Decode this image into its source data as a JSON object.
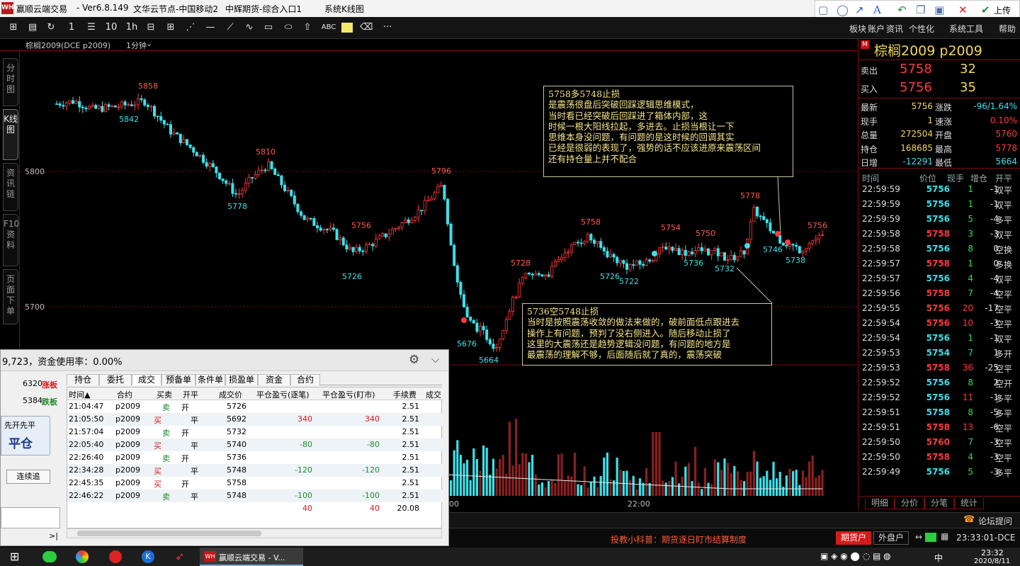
{
  "titlebar": {
    "logo": "WH",
    "app_name": "赢顺云端交易",
    "version": "- Ver6.8.149",
    "node": "文华云节点-中国移动2",
    "futures": "中辉期货-综合入口1",
    "kline_title": "系统K线图"
  },
  "drawtools": {
    "upload_label": "上传"
  },
  "toolbar": {
    "period_1": "1",
    "period_2": "10",
    "period_3": "1h",
    "abc_label": "ABC",
    "more_label": "···"
  },
  "menu": [
    "板块",
    "账户",
    "资讯",
    "个性化",
    "系统工具",
    "帮助"
  ],
  "chartbar": {
    "symbol": "棕榈2009(DCE p2009)",
    "period": "1分钟"
  },
  "side_tabs": [
    "分时图",
    "K线图",
    "资讯链",
    "F10资料",
    "页面下单"
  ],
  "chart": {
    "price_labels": [
      "5800",
      "5700"
    ],
    "time_labels": [
      "00",
      "22:00"
    ],
    "marks": [
      "5858",
      "5842",
      "5810",
      "5778",
      "5796",
      "5756",
      "5726",
      "5728",
      "5676",
      "5664",
      "5758",
      "5754",
      "5750",
      "5726",
      "5722",
      "5736",
      "5732",
      "5778",
      "5746",
      "5756",
      "5738"
    ],
    "bid_marker": "M"
  },
  "chart_data": {
    "type": "candlestick",
    "title": "棕榈2009(DCE p2009)",
    "period": "1分钟",
    "price_axis": [
      "5800",
      "5700"
    ],
    "annotated_highs": [
      5858,
      5810,
      5796,
      5756,
      5728,
      5758,
      5754,
      5750,
      5778,
      5756
    ],
    "annotated_lows": [
      5842,
      5778,
      5726,
      5676,
      5664,
      5726,
      5722,
      5736,
      5732,
      5746,
      5738
    ],
    "colors": {
      "up": "#ff3b3b",
      "down": "#3ee0e8"
    }
  },
  "notes": {
    "long": "5758多5748止损\n是震荡很盘后突破回踩逻辑思维模式，\n当时看已经突破后回踩进了箱体内部，这\n时候一根大阳线拉起，多进去。止损当根让一下\n思维本身没问题，有问题的是这时候的回调其实\n已经是很弱的表现了，强势的话不应该进原来震荡区间\n还有持仓量上并不配合",
    "short": "5736空5748止损\n当时是按照震荡收敛的做法来做的，破前面低点跟进去\n操作上有问题，预判了没右侧进入。随后移动止损了\n这里的大震荡还是趋势逻辑没问题，有问题的地方是\n最震荡的理解不够，后面随后就了真的，震荡突破"
  },
  "quote": {
    "title": "棕榈2009  p2009",
    "sell_label": "卖出",
    "sell_price": "5758",
    "sell_vol": "32",
    "buy_label": "买入",
    "buy_price": "5756",
    "buy_vol": "35",
    "stats": [
      {
        "l1": "最新",
        "v1": "5756",
        "l2": "涨跌",
        "v2": "-96/1.64%"
      },
      {
        "l1": "现手",
        "v1": "1",
        "l2": "速涨",
        "v2": "0.10%"
      },
      {
        "l1": "总量",
        "v1": "272504",
        "l2": "开盘",
        "v2": "5760"
      },
      {
        "l1": "持仓",
        "v1": "168685",
        "l2": "最高",
        "v2": "5778"
      },
      {
        "l1": "日增",
        "v1": "-12291",
        "l2": "最低",
        "v2": "5664"
      }
    ],
    "deal_headers": [
      "时间",
      "价位",
      "现手",
      "增仓",
      "开平"
    ],
    "deals": [
      {
        "time": "22:59:59",
        "price": "5756",
        "vol": "1",
        "chg": "-1",
        "kp": "双平",
        "pc": "#3ee0e8"
      },
      {
        "time": "22:59:59",
        "price": "5756",
        "vol": "1",
        "chg": "-1",
        "kp": "双平",
        "pc": "#3ee0e8"
      },
      {
        "time": "22:59:59",
        "price": "5756",
        "vol": "5",
        "chg": "-4",
        "kp": "多平",
        "pc": "#3ee0e8"
      },
      {
        "time": "22:59:58",
        "price": "5758",
        "vol": "3",
        "chg": "-3",
        "kp": "双平",
        "pc": "#ff3b3b"
      },
      {
        "time": "22:59:58",
        "price": "5756",
        "vol": "8",
        "chg": "0",
        "kp": "空换",
        "pc": "#3ee0e8"
      },
      {
        "time": "22:59:57",
        "price": "5758",
        "vol": "1",
        "chg": "0",
        "kp": "多换",
        "pc": "#ff3b3b"
      },
      {
        "time": "22:59:57",
        "price": "5756",
        "vol": "4",
        "chg": "-4",
        "kp": "双平",
        "pc": "#3ee0e8"
      },
      {
        "time": "22:59:56",
        "price": "5758",
        "vol": "7",
        "chg": "-4",
        "kp": "空平",
        "pc": "#ff3b3b"
      },
      {
        "time": "22:59:55",
        "price": "5756",
        "vol": "20",
        "chg": "-17",
        "kp": "空平",
        "pc": "#ff3b3b"
      },
      {
        "time": "22:59:54",
        "price": "5756",
        "vol": "10",
        "chg": "-3",
        "kp": "空平",
        "pc": "#ff3b3b"
      },
      {
        "time": "22:59:54",
        "price": "5756",
        "vol": "1",
        "chg": "-1",
        "kp": "双平",
        "pc": "#3ee0e8"
      },
      {
        "time": "22:59:53",
        "price": "5754",
        "vol": "7",
        "chg": "1",
        "kp": "多开",
        "pc": "#3ee0e8"
      },
      {
        "time": "22:59:53",
        "price": "5758",
        "vol": "36",
        "chg": "-25",
        "kp": "空平",
        "pc": "#ff3b3b"
      },
      {
        "time": "22:59:52",
        "price": "5756",
        "vol": "8",
        "chg": "2",
        "kp": "空开",
        "pc": "#3ee0e8"
      },
      {
        "time": "22:59:52",
        "price": "5756",
        "vol": "11",
        "chg": "-1",
        "kp": "多平",
        "pc": "#3ee0e8"
      },
      {
        "time": "22:59:51",
        "price": "5758",
        "vol": "8",
        "chg": "-5",
        "kp": "多平",
        "pc": "#3ee0e8"
      },
      {
        "time": "22:59:51",
        "price": "5758",
        "vol": "13",
        "chg": "-6",
        "kp": "空平",
        "pc": "#ff3b3b"
      },
      {
        "time": "22:59:50",
        "price": "5760",
        "vol": "7",
        "chg": "-3",
        "kp": "空平",
        "pc": "#ff3b3b"
      },
      {
        "time": "22:59:50",
        "price": "5758",
        "vol": "4",
        "chg": "-3",
        "kp": "空平",
        "pc": "#ff3b3b"
      },
      {
        "time": "22:59:49",
        "price": "5756",
        "vol": "5",
        "chg": "-3",
        "kp": "多平",
        "pc": "#3ee0e8"
      }
    ],
    "tabs": [
      "明细",
      "分价",
      "分笔",
      "统计"
    ]
  },
  "statusbar": {
    "forum": "论坛提问"
  },
  "infobar": {
    "tip": "投教小科普：期货逐日盯市结算制度",
    "futures_btn": "期货户",
    "external_btn": "外盘户",
    "clock": "23:33:01-DCE"
  },
  "taskbar": {
    "app": "赢顺云端交易 - V...",
    "time": "23:32",
    "date": "2020/8/11",
    "lang": "中"
  },
  "panel": {
    "header_text": "9,723，资金使用率：0.00%",
    "limit_up_price": "6320",
    "limit_up": "涨板",
    "limit_down_price": "5384",
    "limit_down": "跌板",
    "open_close_mode": "先开先平",
    "close_btn": "平仓",
    "chase_btn": "连续追",
    "tabs": [
      "持仓",
      "委托",
      "成交",
      "预备单",
      "条件单",
      "损盈单",
      "资金",
      "合约"
    ],
    "columns": [
      "时间▲",
      "合约",
      "买卖",
      "开平",
      "成交价",
      "平仓盈亏(逐笔)",
      "平仓盈亏(盯市)",
      "手续费",
      "成交"
    ],
    "rows": [
      {
        "time": "21:04:47",
        "contract": "p2009",
        "side": "卖",
        "kp": "开",
        "price": "5726",
        "pl1": "",
        "pl2": "",
        "fee": "2.51"
      },
      {
        "time": "21:05:50",
        "contract": "p2009",
        "side": "买",
        "kp": "平",
        "price": "5692",
        "pl1": "340",
        "pl2": "340",
        "fee": "2.51"
      },
      {
        "time": "21:57:04",
        "contract": "p2009",
        "side": "卖",
        "kp": "开",
        "price": "5732",
        "pl1": "",
        "pl2": "",
        "fee": "2.51"
      },
      {
        "time": "22:05:40",
        "contract": "p2009",
        "side": "买",
        "kp": "平",
        "price": "5740",
        "pl1": "-80",
        "pl2": "-80",
        "fee": "2.51"
      },
      {
        "time": "22:26:40",
        "contract": "p2009",
        "side": "卖",
        "kp": "开",
        "price": "5736",
        "pl1": "",
        "pl2": "",
        "fee": "2.51"
      },
      {
        "time": "22:34:28",
        "contract": "p2009",
        "side": "买",
        "kp": "平",
        "price": "5748",
        "pl1": "-120",
        "pl2": "-120",
        "fee": "2.51"
      },
      {
        "time": "22:45:35",
        "contract": "p2009",
        "side": "买",
        "kp": "开",
        "price": "5758",
        "pl1": "",
        "pl2": "",
        "fee": "2.51"
      },
      {
        "time": "22:46:22",
        "contract": "p2009",
        "side": "卖",
        "kp": "平",
        "price": "5748",
        "pl1": "-100",
        "pl2": "-100",
        "fee": "2.51"
      }
    ],
    "total": {
      "pl1": "40",
      "pl2": "40",
      "fee": "20.08"
    },
    "nav_arrow": ">|"
  }
}
